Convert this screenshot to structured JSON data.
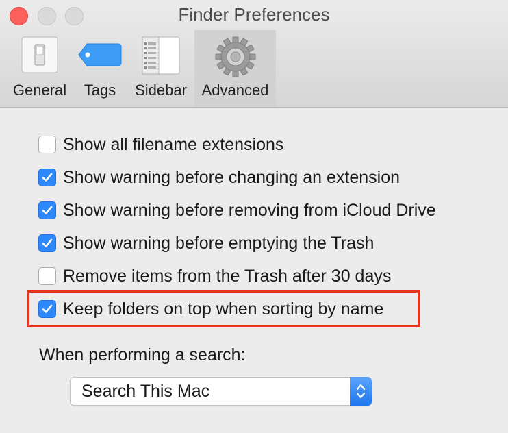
{
  "window": {
    "title": "Finder Preferences"
  },
  "toolbar": {
    "tabs": [
      {
        "label": "General",
        "icon": "general-switch-icon"
      },
      {
        "label": "Tags",
        "icon": "tag-icon"
      },
      {
        "label": "Sidebar",
        "icon": "sidebar-icon"
      },
      {
        "label": "Advanced",
        "icon": "gear-icon",
        "selected": true
      }
    ]
  },
  "options": [
    {
      "label": "Show all filename extensions",
      "checked": false
    },
    {
      "label": "Show warning before changing an extension",
      "checked": true
    },
    {
      "label": "Show warning before removing from iCloud Drive",
      "checked": true
    },
    {
      "label": "Show warning before emptying the Trash",
      "checked": true
    },
    {
      "label": "Remove items from the Trash after 30 days",
      "checked": false
    },
    {
      "label": "Keep folders on top when sorting by name",
      "checked": true,
      "highlighted": true
    }
  ],
  "search": {
    "label": "When performing a search:",
    "selected": "Search This Mac"
  },
  "colors": {
    "accent": "#2f88f9",
    "highlight": "#e6331f"
  }
}
